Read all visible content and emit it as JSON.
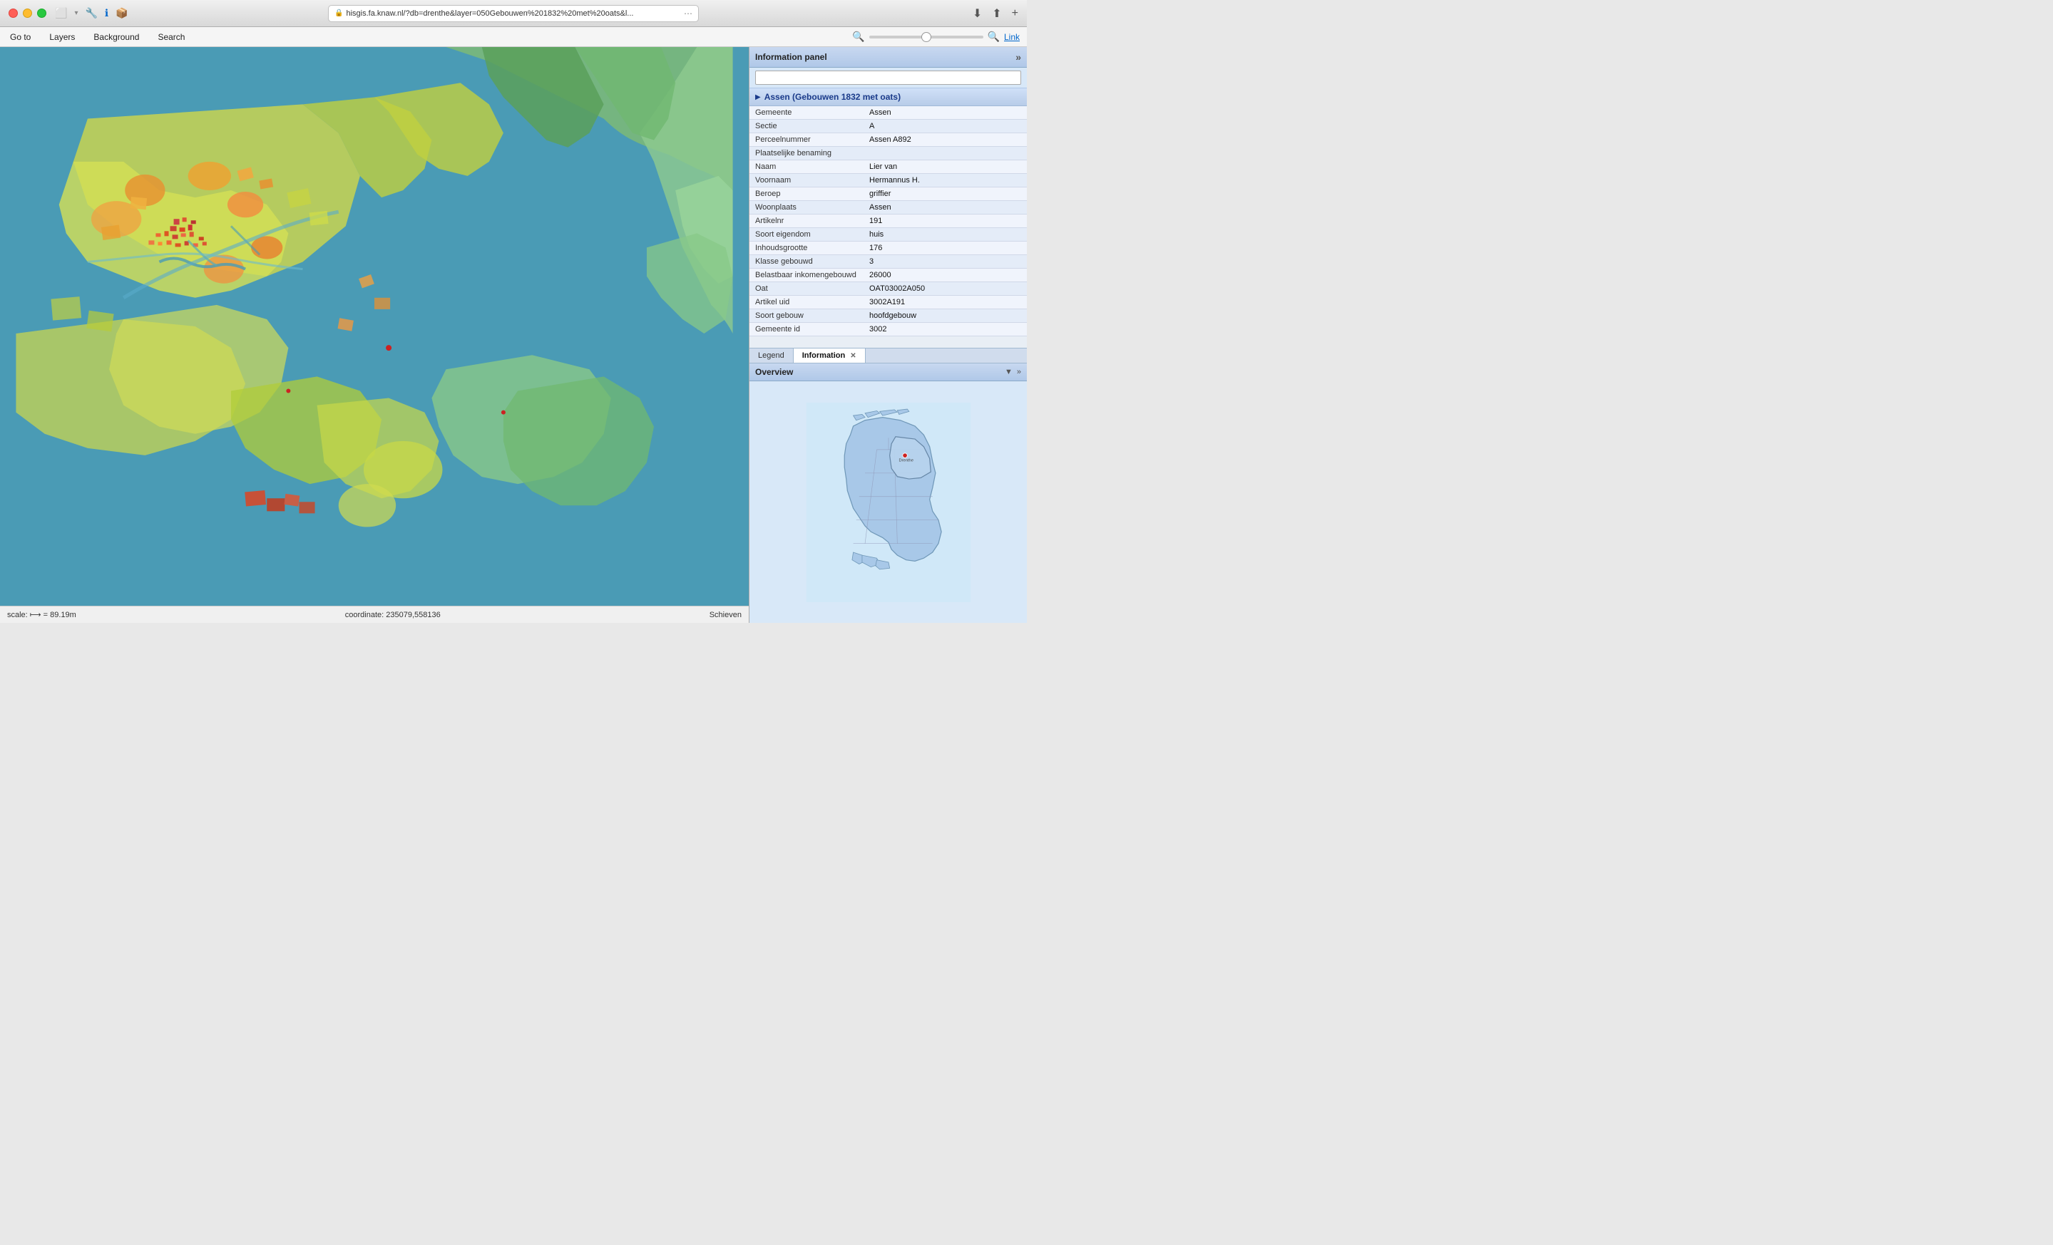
{
  "titlebar": {
    "url": "hisgis.fa.knaw.nl/?db=drenthe&layer=050Gebouwen%201832%20met%20oats&l...",
    "url_display": "hisgis.fa.knaw.nl/?db=drenthe&layer=050Gebouwen%201832%20met%20oats&l..."
  },
  "navbar": {
    "items": [
      {
        "label": "Go to"
      },
      {
        "label": "Layers"
      },
      {
        "label": "Background"
      },
      {
        "label": "Search"
      }
    ],
    "zoom_label": "",
    "link_label": "Link"
  },
  "map": {
    "scale": "scale: ⟼ = 89.19m",
    "coordinate": "coordinate: 235079,558136",
    "attribution": "Schieven"
  },
  "info_panel": {
    "title": "Information panel",
    "search_placeholder": "",
    "section_title": "Assen (Gebouwen 1832 met oats)",
    "rows": [
      {
        "key": "Gemeente",
        "value": "Assen"
      },
      {
        "key": "Sectie",
        "value": "A"
      },
      {
        "key": "Perceelnummer",
        "value": "Assen A892"
      },
      {
        "key": "Plaatselijke benaming",
        "value": ""
      },
      {
        "key": "Naam",
        "value": "Lier van"
      },
      {
        "key": "Voornaam",
        "value": "Hermannus H."
      },
      {
        "key": "Beroep",
        "value": "griffier"
      },
      {
        "key": "Woonplaats",
        "value": "Assen"
      },
      {
        "key": "Artikelnr",
        "value": "191"
      },
      {
        "key": "Soort eigendom",
        "value": "huis"
      },
      {
        "key": "Inhoudsgrootte",
        "value": "176"
      },
      {
        "key": "Klasse gebouwd",
        "value": "3"
      },
      {
        "key": "Belastbaar inkomengebouwd",
        "value": "26000"
      },
      {
        "key": "Oat",
        "value": "OAT03002A050"
      },
      {
        "key": "Artikel uid",
        "value": "3002A191"
      },
      {
        "key": "Soort gebouw",
        "value": "hoofdgebouw"
      },
      {
        "key": "Gemeente id",
        "value": "3002"
      }
    ],
    "tabs": [
      {
        "label": "Legend",
        "active": false,
        "closable": false
      },
      {
        "label": "Information",
        "active": true,
        "closable": true
      }
    ]
  },
  "overview": {
    "title": "Overview"
  }
}
